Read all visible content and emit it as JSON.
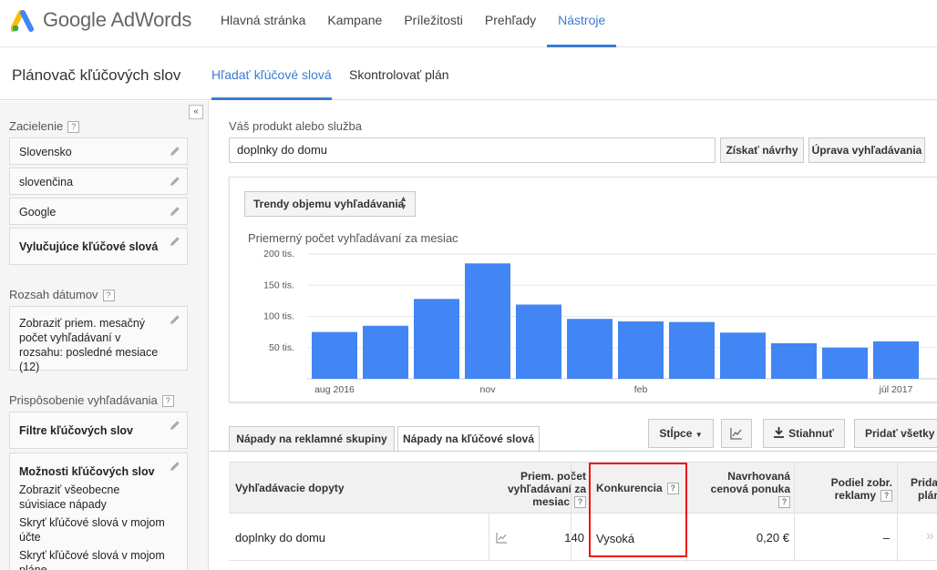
{
  "app": {
    "brand": "Google AdWords"
  },
  "nav": [
    {
      "label": "Hlavná stránka"
    },
    {
      "label": "Kampane"
    },
    {
      "label": "Príležitosti"
    },
    {
      "label": "Prehľady"
    },
    {
      "label": "Nástroje"
    }
  ],
  "planner": {
    "title": "Plánovač kľúčových slov",
    "tabs": [
      {
        "label": "Hľadať kľúčové slová"
      },
      {
        "label": "Skontrolovať plán"
      }
    ]
  },
  "sidebar": {
    "collapse_symbol": "«",
    "targeting_label": "Zacielenie",
    "help_symbol": "?",
    "targeting": [
      {
        "value": "Slovensko"
      },
      {
        "value": "slovenčina"
      },
      {
        "value": "Google"
      },
      {
        "value": "Vylučujúce kľúčové slová"
      }
    ],
    "date_label": "Rozsah dátumov",
    "date_box": "Zobraziť priem. mesačný počet vyhľadávaní v rozsahu: posledné mesiace (12)",
    "customize_label": "Prispôsobenie vyhľadávania",
    "filters": "Filtre kľúčových slov",
    "options_title": "Možnosti kľúčových slov",
    "options": [
      "Zobraziť všeobecne súvisiace nápady",
      "Skryť kľúčové slová v mojom účte",
      "Skryť kľúčové slová v mojom pláne"
    ]
  },
  "search": {
    "label": "Váš produkt alebo služba",
    "value": "doplnky do domu",
    "get_ideas": "Získať návrhy",
    "modify": "Úprava vyhľadávania"
  },
  "chart_section": {
    "select_label": "Trendy objemu vyhľadávania",
    "select_arrows": "▲▼"
  },
  "chart_data": {
    "type": "bar",
    "title": "Priemerný počet vyhľadávaní za mesiac",
    "categories": [
      "aug 2016",
      "sep 2016",
      "okt 2016",
      "nov 2016",
      "dec 2016",
      "jan 2017",
      "feb 2017",
      "mar 2017",
      "apr 2017",
      "máj 2017",
      "jún 2017",
      "júl 2017"
    ],
    "x_tick_labels": [
      "aug 2016",
      "nov",
      "feb",
      "júl 2017"
    ],
    "values": [
      75000,
      85000,
      128000,
      185000,
      119000,
      96000,
      92000,
      91000,
      74000,
      57000,
      50000,
      60000
    ],
    "y_ticks": [
      {
        "value": 50000,
        "label": "50 tis."
      },
      {
        "value": 100000,
        "label": "100 tis."
      },
      {
        "value": 150000,
        "label": "150 tis."
      },
      {
        "value": 200000,
        "label": "200 tis."
      }
    ],
    "ylim": [
      0,
      200000
    ],
    "color": "#4285f4",
    "grid": true
  },
  "results": {
    "tabs": [
      {
        "label": "Nápady na reklamné skupiny"
      },
      {
        "label": "Nápady na kľúčové slová"
      }
    ],
    "columns_btn": "Stĺpce",
    "download_btn": "Stiahnuť",
    "add_all_btn": "Pridať všetky (",
    "headers": {
      "query": "Vyhľadávacie dopyty",
      "avg_searches": [
        "Priem. počet",
        "vyhľadávaní za",
        "mesiac"
      ],
      "competition": "Konkurencia",
      "bid": [
        "Navrhovaná",
        "cenová ponuka"
      ],
      "share": [
        "Podiel zobr.",
        "reklamy"
      ],
      "add": [
        "Prida",
        "plán"
      ]
    },
    "rows": [
      {
        "query": "doplnky do domu",
        "avg": "140",
        "competition": "Vysoká",
        "bid": "0,20 €",
        "share": "–",
        "add": "»"
      }
    ]
  }
}
